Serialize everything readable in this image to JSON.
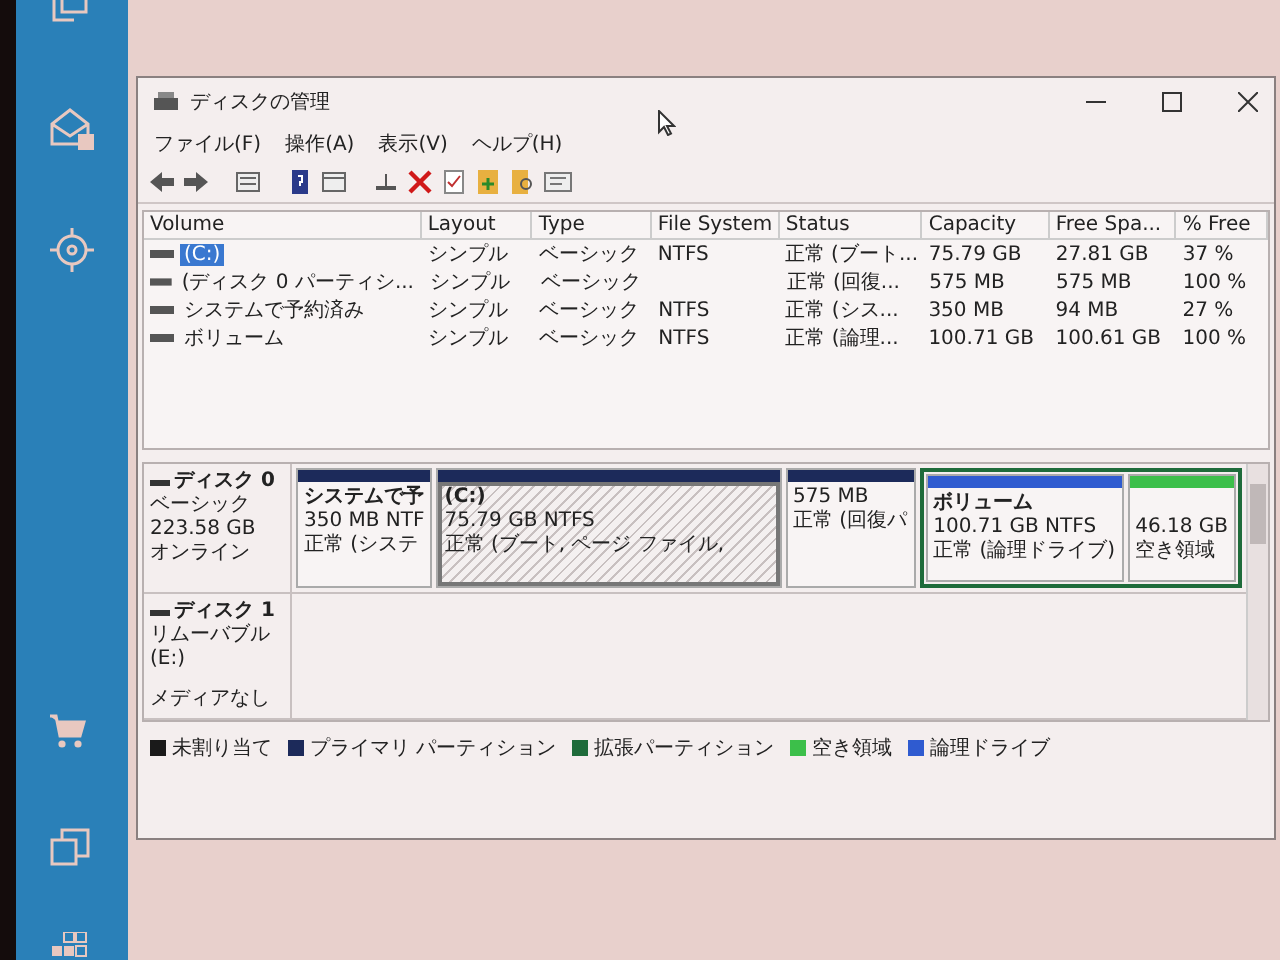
{
  "window": {
    "title": "ディスクの管理"
  },
  "menu": [
    "ファイル(F)",
    "操作(A)",
    "表示(V)",
    "ヘルプ(H)"
  ],
  "table": {
    "columns": [
      "Volume",
      "Layout",
      "Type",
      "File System",
      "Status",
      "Capacity",
      "Free Spa...",
      "% Free"
    ],
    "rows": [
      {
        "selected": true,
        "cells": [
          "(C:)",
          "シンプル",
          "ベーシック",
          "NTFS",
          "正常 (ブート...",
          "75.79 GB",
          "27.81 GB",
          "37 %"
        ]
      },
      {
        "selected": false,
        "cells": [
          "(ディスク 0 パーティシ...",
          "シンプル",
          "ベーシック",
          "",
          "正常 (回復...",
          "575 MB",
          "575 MB",
          "100 %"
        ]
      },
      {
        "selected": false,
        "cells": [
          "システムで予約済み",
          "シンプル",
          "ベーシック",
          "NTFS",
          "正常 (シス...",
          "350 MB",
          "94 MB",
          "27 %"
        ]
      },
      {
        "selected": false,
        "cells": [
          "ボリューム",
          "シンプル",
          "ベーシック",
          "NTFS",
          "正常 (論理...",
          "100.71 GB",
          "100.61 GB",
          "100 %"
        ]
      }
    ]
  },
  "disks": [
    {
      "name": "ディスク 0",
      "lines": [
        "ベーシック",
        "223.58 GB",
        "オンライン"
      ],
      "partitions": [
        {
          "kind": "primary",
          "color": "#1c2a5a",
          "selected": false,
          "lines": [
            "システムで予",
            "350 MB NTF",
            "正常 (システ"
          ]
        },
        {
          "kind": "primary",
          "color": "#1c2a5a",
          "selected": true,
          "lines": [
            "(C:)",
            "75.79 GB NTFS",
            "正常 (ブート, ページ ファイル,"
          ]
        },
        {
          "kind": "primary",
          "color": "#1c2a5a",
          "selected": false,
          "lines": [
            "575 MB",
            "正常 (回復パ"
          ]
        },
        {
          "kind": "extended",
          "children": [
            {
              "kind": "primary",
              "color": "#2f5bd0",
              "selected": false,
              "lines": [
                "ボリューム",
                "100.71 GB NTFS",
                "正常 (論理ドライブ)"
              ]
            },
            {
              "kind": "primary",
              "color": "#3cbf4a",
              "selected": false,
              "lines": [
                "46.18 GB",
                "空き領域"
              ]
            }
          ]
        }
      ]
    },
    {
      "name": "ディスク 1",
      "lines": [
        "リムーバブル (E:)",
        "メディアなし"
      ]
    }
  ],
  "legend": [
    {
      "label": "未割り当て",
      "color": "#1a1a1a"
    },
    {
      "label": "プライマリ パーティション",
      "color": "#1c2a5a"
    },
    {
      "label": "拡張パーティション",
      "color": "#1e6b3a"
    },
    {
      "label": "空き領域",
      "color": "#3cbf4a"
    },
    {
      "label": "論理ドライブ",
      "color": "#2f5bd0"
    }
  ]
}
